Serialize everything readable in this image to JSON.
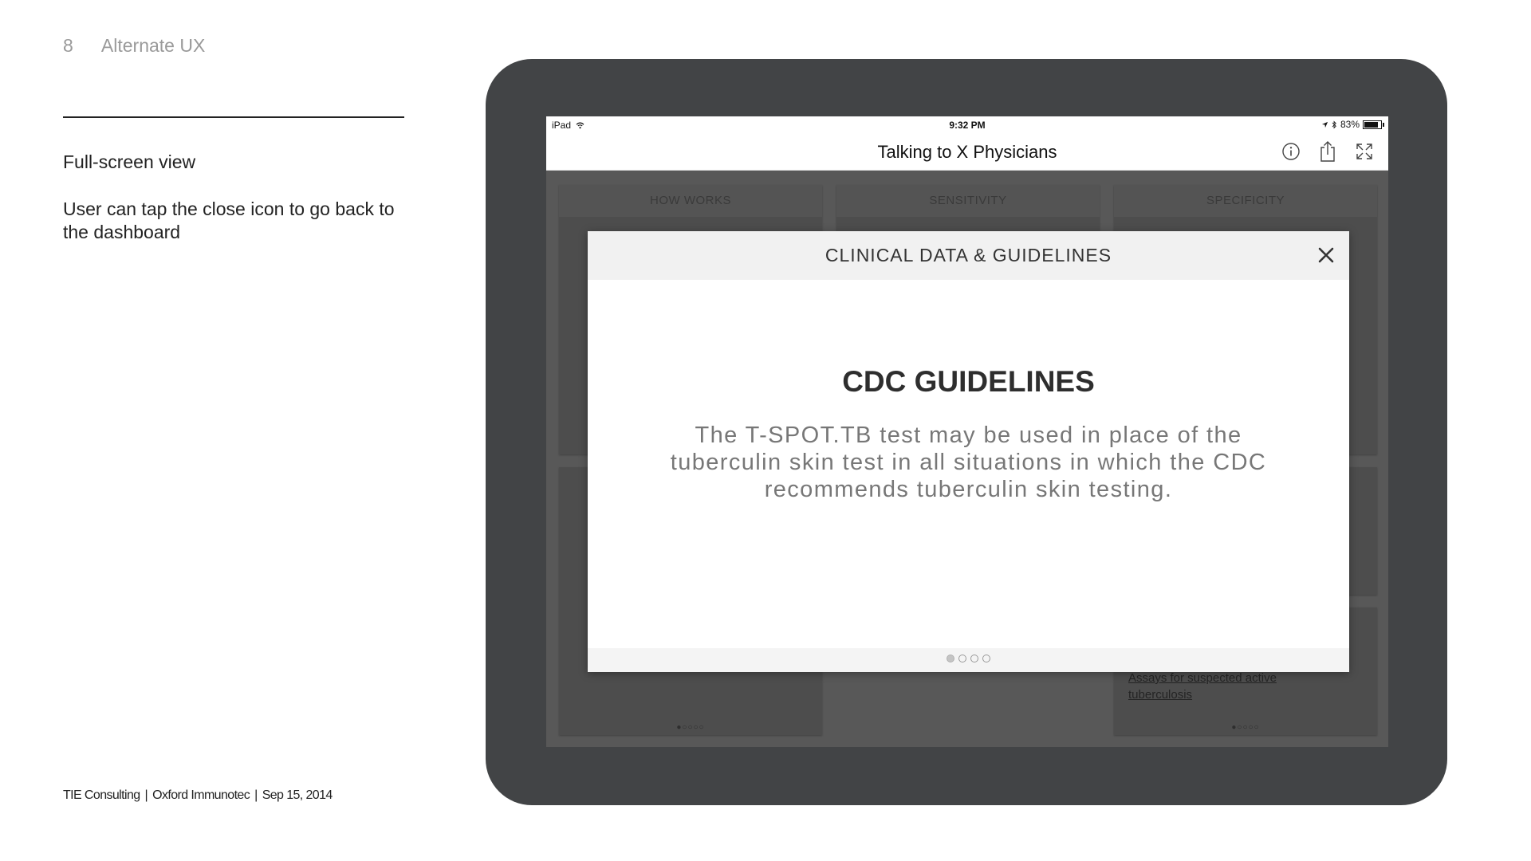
{
  "slide": {
    "number": "8",
    "section": "Alternate UX",
    "notes": [
      "Full-screen view",
      "User can tap the close icon to go back to the dashboard"
    ],
    "footer": {
      "company": "TIE Consulting",
      "client": "Oxford Immunotec",
      "date": "Sep 15, 2014"
    }
  },
  "device": {
    "status": {
      "carrier": "iPad",
      "time": "9:32 PM",
      "battery": "83%"
    },
    "nav": {
      "title": "Talking to X Physicians",
      "icons": [
        "info-icon",
        "share-icon",
        "expand-icon"
      ]
    },
    "dashboard": {
      "cards": [
        {
          "heading": "HOW WORKS",
          "dots": "●○○○○"
        },
        {
          "heading": "SENSITIVITY",
          "dots": ""
        },
        {
          "heading": "SPECIFICITY",
          "dots": "●○○○○"
        }
      ],
      "link_fragment_1": "Assays for suspected active",
      "link_fragment_2": "tuberculosis"
    },
    "modal": {
      "title": "CLINICAL DATA & GUIDELINES",
      "content_title": "CDC GUIDELINES",
      "content_text": "The T-SPOT.TB test may be used in place of the tuberculin skin test in all situations in which the CDC recommends tuberculin skin testing.",
      "pager": {
        "total": 4,
        "current": 1
      },
      "close_icon": "close-icon"
    }
  }
}
